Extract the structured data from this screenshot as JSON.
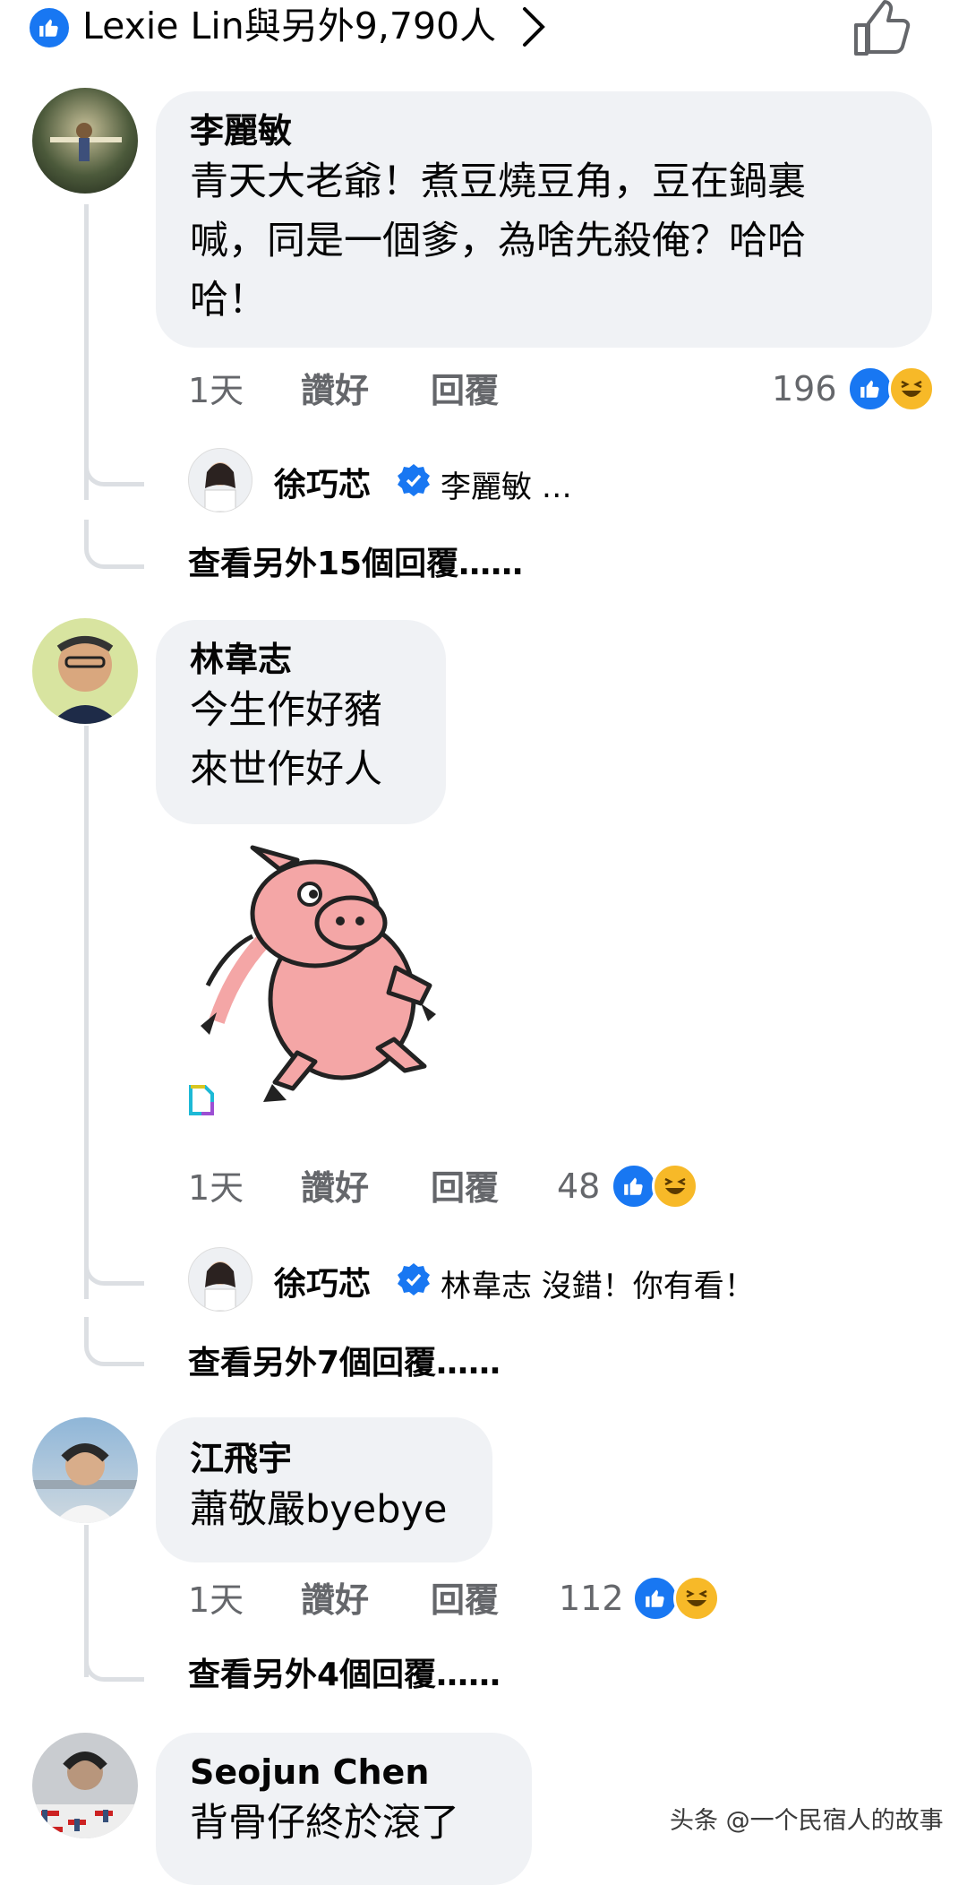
{
  "header": {
    "reactors_text": "Lexie Lin與另外9,790人"
  },
  "comments": [
    {
      "author": "李麗敏",
      "lines": [
        "青天大老爺！煮豆燒豆角，豆在鍋裏",
        "喊，同是一個爹，為啥先殺俺？哈哈",
        "哈！"
      ],
      "time": "1天",
      "like_label": "讚好",
      "reply_label": "回覆",
      "reaction_count": "196",
      "reply": {
        "author": "徐巧芯",
        "text": "李麗敏 …"
      },
      "more_replies": "查看另外15個回覆……"
    },
    {
      "author": "林韋志",
      "lines": [
        "今生作好豬",
        "來世作好人"
      ],
      "time": "1天",
      "like_label": "讚好",
      "reply_label": "回覆",
      "reaction_count": "48",
      "reply": {
        "author": "徐巧芯",
        "text": "林韋志 沒錯！你有看！"
      },
      "more_replies": "查看另外7個回覆……"
    },
    {
      "author": "江飛宇",
      "lines": [
        "蕭敬嚴byebye"
      ],
      "time": "1天",
      "like_label": "讚好",
      "reply_label": "回覆",
      "reaction_count": "112",
      "more_replies": "查看另外4個回覆……"
    },
    {
      "author": "Seojun Chen",
      "lines": [
        "背骨仔終於滾了"
      ]
    }
  ],
  "watermark": "头条 @一个民宿人的故事",
  "colors": {
    "like_blue": "#1877f2",
    "haha_yellow": "#f7b928",
    "bubble_bg": "#f0f2f5",
    "meta_gray": "#65676b"
  }
}
